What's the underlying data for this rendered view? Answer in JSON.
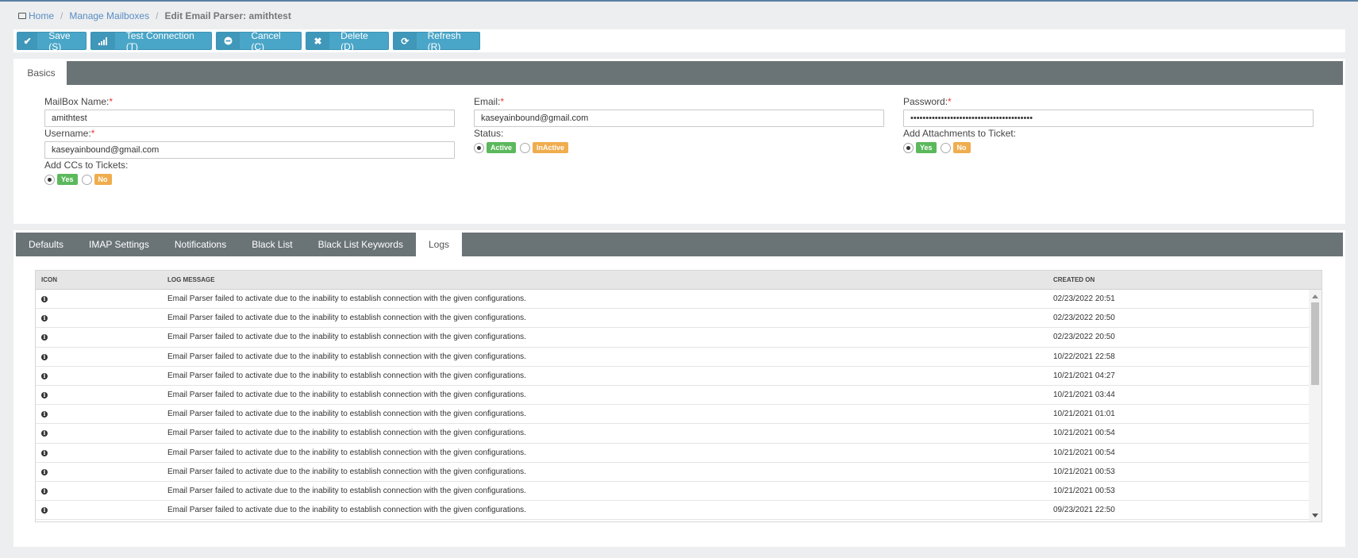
{
  "breadcrumb": {
    "home": "Home",
    "manage": "Manage Mailboxes",
    "current": "Edit Email Parser: amithtest"
  },
  "toolbar": {
    "save": "Save (S)",
    "test": "Test Connection (T)",
    "cancel": "Cancel (C)",
    "delete": "Delete (D)",
    "refresh": "Refresh (R)"
  },
  "basics": {
    "tab": "Basics",
    "mailbox_name": {
      "label": "MailBox Name:",
      "value": "amithtest"
    },
    "email": {
      "label": "Email:",
      "value": "kaseyainbound@gmail.com"
    },
    "password": {
      "label": "Password:",
      "value": "••••••••••••••••••••••••••••••••••••••••"
    },
    "username": {
      "label": "Username:",
      "value": "kaseyainbound@gmail.com"
    },
    "status": {
      "label": "Status:",
      "active": "Active",
      "inactive": "InActive"
    },
    "attachments": {
      "label": "Add Attachments to Ticket:",
      "yes": "Yes",
      "no": "No"
    },
    "ccs": {
      "label": "Add CCs to Tickets:",
      "yes": "Yes",
      "no": "No"
    },
    "required": "*"
  },
  "tabs": [
    "Defaults",
    "IMAP Settings",
    "Notifications",
    "Black List",
    "Black List Keywords",
    "Logs"
  ],
  "logs": {
    "headers": {
      "icon": "ICON",
      "message": "LOG MESSAGE",
      "created": "CREATED ON"
    },
    "rows": [
      {
        "msg": "Email Parser failed to activate due to the inability to establish connection with the given configurations.",
        "date": "02/23/2022 20:51"
      },
      {
        "msg": "Email Parser failed to activate due to the inability to establish connection with the given configurations.",
        "date": "02/23/2022 20:50"
      },
      {
        "msg": "Email Parser failed to activate due to the inability to establish connection with the given configurations.",
        "date": "02/23/2022 20:50"
      },
      {
        "msg": "Email Parser failed to activate due to the inability to establish connection with the given configurations.",
        "date": "10/22/2021 22:58"
      },
      {
        "msg": "Email Parser failed to activate due to the inability to establish connection with the given configurations.",
        "date": "10/21/2021 04:27"
      },
      {
        "msg": "Email Parser failed to activate due to the inability to establish connection with the given configurations.",
        "date": "10/21/2021 03:44"
      },
      {
        "msg": "Email Parser failed to activate due to the inability to establish connection with the given configurations.",
        "date": "10/21/2021 01:01"
      },
      {
        "msg": "Email Parser failed to activate due to the inability to establish connection with the given configurations.",
        "date": "10/21/2021 00:54"
      },
      {
        "msg": "Email Parser failed to activate due to the inability to establish connection with the given configurations.",
        "date": "10/21/2021 00:54"
      },
      {
        "msg": "Email Parser failed to activate due to the inability to establish connection with the given configurations.",
        "date": "10/21/2021 00:53"
      },
      {
        "msg": "Email Parser failed to activate due to the inability to establish connection with the given configurations.",
        "date": "10/21/2021 00:53"
      },
      {
        "msg": "Email Parser failed to activate due to the inability to establish connection with the given configurations.",
        "date": "09/23/2021 22:50"
      }
    ]
  },
  "icons": {
    "save": "check-icon",
    "test": "signal-icon",
    "cancel": "minus-circle-icon",
    "delete": "x-icon",
    "refresh": "refresh-icon",
    "log": "info-icon"
  },
  "colors": {
    "button": "#4aa6c8",
    "tabbar": "#6a7376",
    "active_badge": "#5cb85c",
    "inactive_badge": "#f0ad4e",
    "required": "#e53935"
  }
}
